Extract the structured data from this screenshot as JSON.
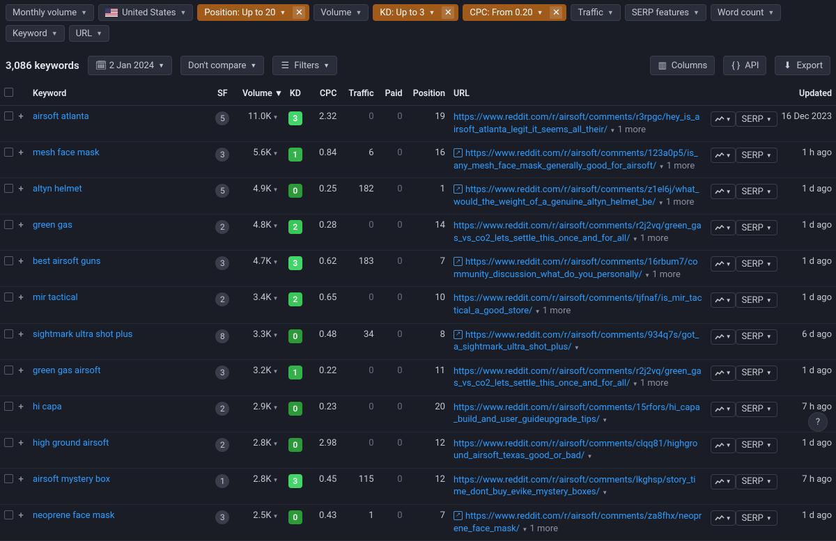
{
  "filters": {
    "monthly_volume": "Monthly volume",
    "country": "United States",
    "position": "Position: Up to 20",
    "volume": "Volume",
    "kd": "KD: Up to 3",
    "cpc": "CPC: From 0.20",
    "traffic": "Traffic",
    "serp_features": "SERP features",
    "word_count": "Word count",
    "keyword": "Keyword",
    "url": "URL"
  },
  "toolbar": {
    "keywords_count": "3,086 keywords",
    "date": "2 Jan 2024",
    "compare": "Don't compare",
    "filters": "Filters",
    "columns": "Columns",
    "api": "API",
    "export": "Export"
  },
  "headers": {
    "keyword": "Keyword",
    "sf": "SF",
    "volume": "Volume",
    "kd": "KD",
    "cpc": "CPC",
    "traffic": "Traffic",
    "paid": "Paid",
    "position": "Position",
    "url": "URL",
    "updated": "Updated"
  },
  "serp_label": "SERP",
  "more_label": "1 more",
  "rows": [
    {
      "keyword": "airsoft atlanta",
      "sf": "5",
      "volume": "11.0K",
      "kd": "3",
      "cpc": "2.32",
      "traffic": "0",
      "paid": "0",
      "position": "19",
      "url": "https://www.reddit.com/r/airsoft/comments/r3rpgc/hey_is_airsoft_atlanta_legit_it_seems_all_their/",
      "more": true,
      "icon": false,
      "updated": "16 Dec 2023",
      "traffic_dim": true
    },
    {
      "keyword": "mesh face mask",
      "sf": "3",
      "volume": "5.6K",
      "kd": "1",
      "cpc": "0.84",
      "traffic": "6",
      "paid": "0",
      "position": "16",
      "url": "https://www.reddit.com/r/airsoft/comments/123a0p5/is_any_mesh_face_mask_generally_good_for_airsoft/",
      "more": true,
      "icon": true,
      "updated": "1 h ago",
      "traffic_dim": false
    },
    {
      "keyword": "altyn helmet",
      "sf": "5",
      "volume": "4.9K",
      "kd": "0",
      "cpc": "0.25",
      "traffic": "182",
      "paid": "0",
      "position": "1",
      "url": "https://www.reddit.com/r/airsoft/comments/z1el6j/what_would_the_weight_of_a_genuine_altyn_helmet_be/",
      "more": true,
      "icon": true,
      "updated": "1 d ago",
      "traffic_dim": false
    },
    {
      "keyword": "green gas",
      "sf": "2",
      "volume": "4.8K",
      "kd": "2",
      "cpc": "0.28",
      "traffic": "0",
      "paid": "0",
      "position": "14",
      "url": "https://www.reddit.com/r/airsoft/comments/r2j2vq/green_gas_vs_co2_lets_settle_this_once_and_for_all/",
      "more": true,
      "icon": false,
      "updated": "1 d ago",
      "traffic_dim": true
    },
    {
      "keyword": "best airsoft guns",
      "sf": "3",
      "volume": "4.7K",
      "kd": "3",
      "cpc": "0.62",
      "traffic": "183",
      "paid": "0",
      "position": "7",
      "url": "https://www.reddit.com/r/airsoft/comments/16rbum7/community_discussion_what_do_you_personally/",
      "more": true,
      "icon": true,
      "updated": "1 d ago",
      "traffic_dim": false
    },
    {
      "keyword": "mir tactical",
      "sf": "2",
      "volume": "3.4K",
      "kd": "2",
      "cpc": "0.65",
      "traffic": "0",
      "paid": "0",
      "position": "10",
      "url": "https://www.reddit.com/r/airsoft/comments/tjfnaf/is_mir_tactical_a_good_store/",
      "more": true,
      "icon": false,
      "updated": "1 d ago",
      "traffic_dim": true
    },
    {
      "keyword": "sightmark ultra shot plus",
      "sf": "8",
      "volume": "3.3K",
      "kd": "0",
      "cpc": "0.48",
      "traffic": "34",
      "paid": "0",
      "position": "8",
      "url": "https://www.reddit.com/r/airsoft/comments/934q7s/got_a_sightmark_ultra_shot_plus/",
      "more": false,
      "icon": true,
      "updated": "6 d ago",
      "traffic_dim": false
    },
    {
      "keyword": "green gas airsoft",
      "sf": "3",
      "volume": "3.2K",
      "kd": "1",
      "cpc": "0.22",
      "traffic": "0",
      "paid": "0",
      "position": "11",
      "url": "https://www.reddit.com/r/airsoft/comments/r2j2vq/green_gas_vs_co2_lets_settle_this_once_and_for_all/",
      "more": true,
      "icon": false,
      "updated": "1 d ago",
      "traffic_dim": true
    },
    {
      "keyword": "hi capa",
      "sf": "2",
      "volume": "2.9K",
      "kd": "0",
      "cpc": "0.23",
      "traffic": "0",
      "paid": "0",
      "position": "20",
      "url": "https://www.reddit.com/r/airsoft/comments/15rfors/hi_capa_build_and_user_guideupgrade_tips/",
      "more": false,
      "icon": false,
      "updated": "7 h ago",
      "traffic_dim": true
    },
    {
      "keyword": "high ground airsoft",
      "sf": "2",
      "volume": "2.8K",
      "kd": "0",
      "cpc": "2.98",
      "traffic": "0",
      "paid": "0",
      "position": "12",
      "url": "https://www.reddit.com/r/airsoft/comments/clqq81/highground_airsoft_texas_good_or_bad/",
      "more": false,
      "icon": false,
      "updated": "1 d ago",
      "traffic_dim": true
    },
    {
      "keyword": "airsoft mystery box",
      "sf": "1",
      "volume": "2.8K",
      "kd": "3",
      "cpc": "0.45",
      "traffic": "115",
      "paid": "0",
      "position": "12",
      "url": "https://www.reddit.com/r/airsoft/comments/lkghsp/story_time_dont_buy_evike_mystery_boxes/",
      "more": false,
      "icon": false,
      "updated": "7 h ago",
      "traffic_dim": false
    },
    {
      "keyword": "neoprene face mask",
      "sf": "3",
      "volume": "2.5K",
      "kd": "0",
      "cpc": "0.43",
      "traffic": "1",
      "paid": "0",
      "position": "7",
      "url": "https://www.reddit.com/r/airsoft/comments/za8fhx/neoprene_face_mask/",
      "more": true,
      "icon": true,
      "updated": "1 d ago",
      "traffic_dim": false
    }
  ]
}
